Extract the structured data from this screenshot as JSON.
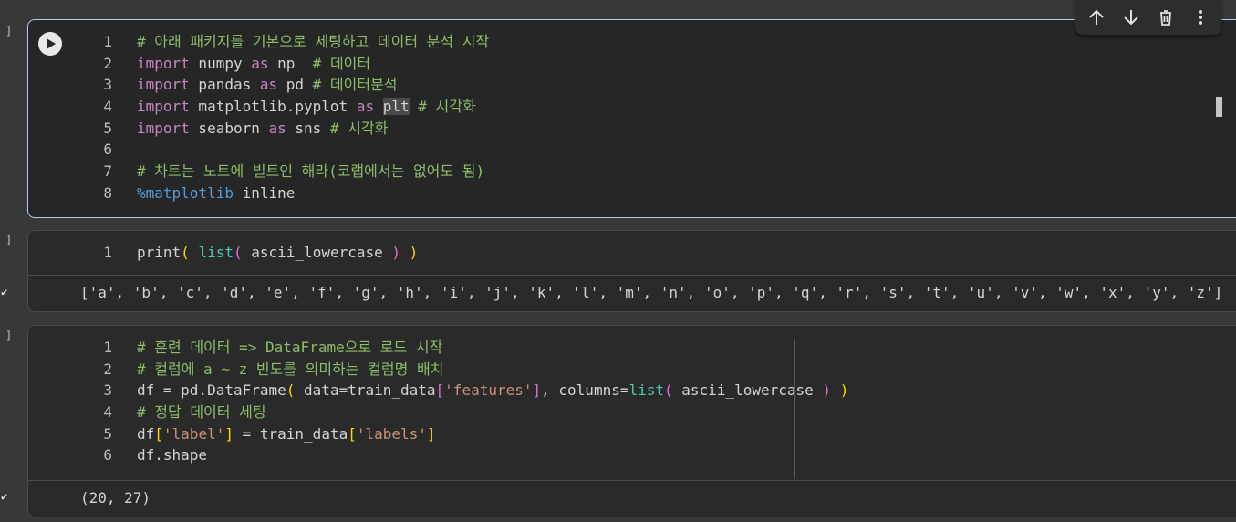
{
  "gutter": {
    "cell1_bracket": "]",
    "cell2_bracket": "]",
    "cell3_bracket": "]",
    "checkmark": "✔"
  },
  "toolbar": {
    "icons": [
      "arrow-up-icon",
      "arrow-down-icon",
      "trash-icon",
      "more-vert-icon"
    ]
  },
  "cells": [
    {
      "lines": [
        {
          "n": "1",
          "parts": [
            {
              "t": "# 아래 패키지를 기본으로 세팅하고 데이터 분석 시작",
              "c": "cmt"
            }
          ]
        },
        {
          "n": "2",
          "parts": [
            {
              "t": "import",
              "c": "kw"
            },
            {
              "t": " numpy ",
              "c": ""
            },
            {
              "t": "as",
              "c": "kw"
            },
            {
              "t": " np  ",
              "c": ""
            },
            {
              "t": "# 데이터",
              "c": "cmt"
            }
          ]
        },
        {
          "n": "3",
          "parts": [
            {
              "t": "import",
              "c": "kw"
            },
            {
              "t": " pandas ",
              "c": ""
            },
            {
              "t": "as",
              "c": "kw"
            },
            {
              "t": " pd ",
              "c": ""
            },
            {
              "t": "# 데이터분석",
              "c": "cmt"
            }
          ]
        },
        {
          "n": "4",
          "parts": [
            {
              "t": "import",
              "c": "kw"
            },
            {
              "t": " matplotlib.pyplot ",
              "c": ""
            },
            {
              "t": "as",
              "c": "kw"
            },
            {
              "t": " ",
              "c": ""
            },
            {
              "t": "plt",
              "c": "sel"
            },
            {
              "t": " ",
              "c": ""
            },
            {
              "t": "# 시각화",
              "c": "cmt"
            }
          ]
        },
        {
          "n": "5",
          "parts": [
            {
              "t": "import",
              "c": "kw"
            },
            {
              "t": " seaborn ",
              "c": ""
            },
            {
              "t": "as",
              "c": "kw"
            },
            {
              "t": " sns ",
              "c": ""
            },
            {
              "t": "# 시각화",
              "c": "cmt"
            }
          ]
        },
        {
          "n": "6",
          "parts": []
        },
        {
          "n": "7",
          "parts": [
            {
              "t": "# 차트는 노트에 빌트인 해라(코랩에서는 없어도 됨)",
              "c": "cmt"
            }
          ]
        },
        {
          "n": "8",
          "parts": [
            {
              "t": "%matplotlib",
              "c": "mag"
            },
            {
              "t": " inline",
              "c": ""
            }
          ]
        }
      ]
    },
    {
      "lines": [
        {
          "n": "1",
          "parts": [
            {
              "t": "print",
              "c": ""
            },
            {
              "t": "(",
              "c": "br1"
            },
            {
              "t": " ",
              "c": ""
            },
            {
              "t": "list",
              "c": "fn"
            },
            {
              "t": "(",
              "c": "br2"
            },
            {
              "t": " ascii_lowercase ",
              "c": ""
            },
            {
              "t": ")",
              "c": "br2"
            },
            {
              "t": " ",
              "c": ""
            },
            {
              "t": ")",
              "c": "br1"
            }
          ]
        }
      ],
      "output": "['a', 'b', 'c', 'd', 'e', 'f', 'g', 'h', 'i', 'j', 'k', 'l', 'm', 'n', 'o', 'p', 'q', 'r', 's', 't', 'u', 'v', 'w', 'x', 'y', 'z']"
    },
    {
      "lines": [
        {
          "n": "1",
          "parts": [
            {
              "t": "# 훈련 데이터 => DataFrame으로 로드 시작",
              "c": "cmt"
            }
          ]
        },
        {
          "n": "2",
          "parts": [
            {
              "t": "# 컬럼에 a ~ z 빈도를 의미하는 컬럼명 배치",
              "c": "cmt"
            }
          ]
        },
        {
          "n": "3",
          "parts": [
            {
              "t": "df = pd.DataFrame",
              "c": ""
            },
            {
              "t": "(",
              "c": "br1"
            },
            {
              "t": " data=train_data",
              "c": ""
            },
            {
              "t": "[",
              "c": "br2"
            },
            {
              "t": "'features'",
              "c": "str"
            },
            {
              "t": "]",
              "c": "br2"
            },
            {
              "t": ", columns=",
              "c": ""
            },
            {
              "t": "list",
              "c": "fn"
            },
            {
              "t": "(",
              "c": "br2"
            },
            {
              "t": " ascii_lowercase ",
              "c": ""
            },
            {
              "t": ")",
              "c": "br2"
            },
            {
              "t": " ",
              "c": ""
            },
            {
              "t": ")",
              "c": "br1"
            }
          ]
        },
        {
          "n": "4",
          "parts": [
            {
              "t": "# 정답 데이터 세팅",
              "c": "cmt"
            }
          ]
        },
        {
          "n": "5",
          "parts": [
            {
              "t": "df",
              "c": ""
            },
            {
              "t": "[",
              "c": "br1"
            },
            {
              "t": "'label'",
              "c": "str"
            },
            {
              "t": "]",
              "c": "br1"
            },
            {
              "t": " = train_data",
              "c": ""
            },
            {
              "t": "[",
              "c": "br1"
            },
            {
              "t": "'labels'",
              "c": "str"
            },
            {
              "t": "]",
              "c": "br1"
            }
          ]
        },
        {
          "n": "6",
          "parts": [
            {
              "t": "df.shape",
              "c": ""
            }
          ]
        }
      ],
      "output": "(20, 27)"
    }
  ]
}
